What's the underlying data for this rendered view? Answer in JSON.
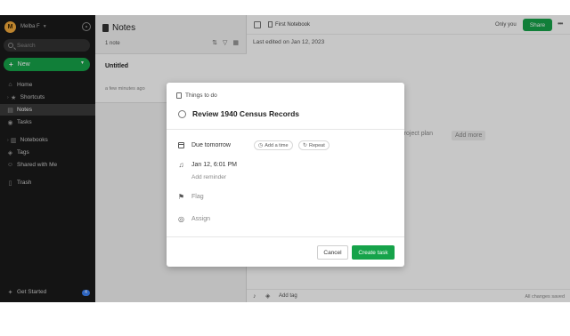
{
  "sidebar": {
    "avatar_letter": "M",
    "user_name": "Melba F",
    "search_placeholder": "Search",
    "new_label": "New",
    "nav": [
      {
        "label": "Home",
        "icon": "home-icon"
      },
      {
        "label": "Shortcuts",
        "icon": "star-icon"
      },
      {
        "label": "Notes",
        "icon": "note-icon"
      },
      {
        "label": "Tasks",
        "icon": "check-circle-icon"
      },
      {
        "label": "Notebooks",
        "icon": "notebook-icon"
      },
      {
        "label": "Tags",
        "icon": "tag-icon"
      },
      {
        "label": "Shared with Me",
        "icon": "people-icon"
      },
      {
        "label": "Trash",
        "icon": "trash-icon"
      }
    ],
    "get_started": "Get Started",
    "get_started_badge": "4"
  },
  "notes_list": {
    "title": "Notes",
    "count": "1 note",
    "items": [
      {
        "title": "Untitled",
        "time": "a few minutes ago"
      }
    ]
  },
  "editor": {
    "notebook": "First Notebook",
    "only_you": "Only you",
    "share_label": "Share",
    "last_edited": "Last edited on Jan 12, 2023",
    "bg_project_plan": "Project plan",
    "bg_add_more": "Add more",
    "add_tag": "Add tag",
    "saved_status": "All changes saved"
  },
  "modal": {
    "header": "Things to do",
    "task_title": "Review 1940 Census Records",
    "due": "Due tomorrow",
    "add_time": "Add a time",
    "repeat": "Repeat",
    "reminder": "Jan 12, 6:01 PM",
    "add_reminder": "Add reminder",
    "flag": "Flag",
    "assign": "Assign",
    "cancel": "Cancel",
    "create": "Create task"
  },
  "colors": {
    "accent_green": "#16a34a",
    "sidebar_bg": "#1a1a1a",
    "avatar": "#f2a93b",
    "badge": "#3b82f6"
  }
}
